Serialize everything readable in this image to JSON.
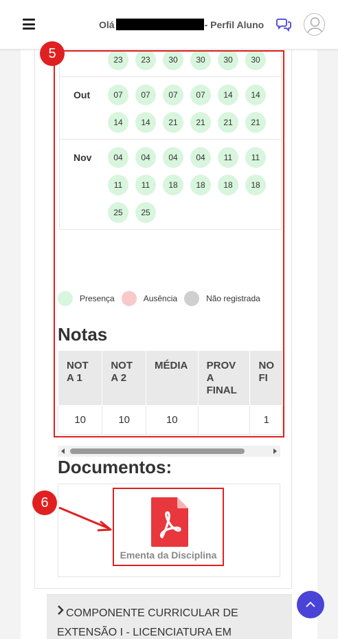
{
  "navbar": {
    "greeting_prefix": "Olá",
    "greeting_suffix": "- Perfil Aluno",
    "menu_icon": "hamburger-icon",
    "chat_icon": "comments-icon",
    "avatar_icon": "user-avatar-icon"
  },
  "annotations": {
    "badge5": "5",
    "badge6": "6",
    "highlight_color": "#e02020"
  },
  "attendance": {
    "months": [
      {
        "name": "",
        "days": [
          "23",
          "23",
          "30",
          "30",
          "30",
          "30"
        ]
      },
      {
        "name": "Out",
        "days": [
          "07",
          "07",
          "07",
          "07",
          "14",
          "14",
          "14",
          "14",
          "21",
          "21",
          "21",
          "21"
        ]
      },
      {
        "name": "Nov",
        "days": [
          "04",
          "04",
          "04",
          "04",
          "11",
          "11",
          "11",
          "11",
          "18",
          "18",
          "18",
          "18",
          "25",
          "25"
        ]
      }
    ],
    "legend": [
      {
        "label": "Presença",
        "color": "#d8f5dd"
      },
      {
        "label": "Ausência",
        "color": "#f8c9c9"
      },
      {
        "label": "Não registrada",
        "color": "#cfcfcf"
      }
    ]
  },
  "grades": {
    "title": "Notas",
    "headers": [
      "NOT A 1",
      "NOT A 2",
      "MÉDIA",
      "PROV A FINAL",
      "NO FI"
    ],
    "row": [
      "10",
      "10",
      "10",
      "",
      "1"
    ]
  },
  "documents": {
    "title": "Documentos:",
    "items": [
      {
        "label": "Ementa da Disciplina",
        "icon": "file-pdf-icon",
        "color": "#e8383d"
      }
    ]
  },
  "accordion": {
    "label": "COMPONENTE CURRICULAR DE EXTENSÃO I - LICENCIATURA EM"
  },
  "scroll_top": {
    "icon": "chevron-up-icon",
    "color": "#4a43d8"
  }
}
